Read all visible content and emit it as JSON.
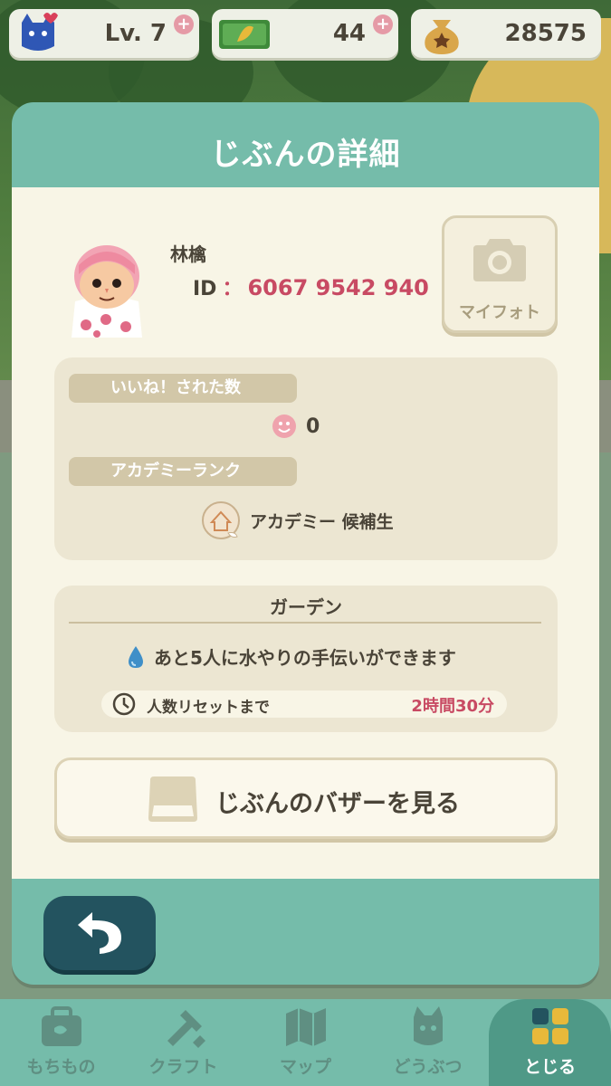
{
  "status_bar": {
    "level_label": "Lv. 7",
    "tickets_value": "44",
    "bells_value": "28575",
    "plus_symbol": "+"
  },
  "modal": {
    "title": "じぶんの詳細",
    "profile": {
      "name": "林檎",
      "id_label": "ID",
      "id_colon": "：",
      "id_value": "6067 9542 940",
      "myphoto_label": "マイフォト"
    },
    "likes": {
      "label": "いいね！された数",
      "value": "0"
    },
    "academy": {
      "label": "アカデミーランク",
      "value": "アカデミー 候補生"
    },
    "garden": {
      "title": "ガーデン",
      "water_text": "あと5人に水やりの手伝いができます",
      "reset_label": "人数リセットまで",
      "reset_time": "2時間30分"
    },
    "bazaar_label": "じぶんのバザーを見る"
  },
  "bottom_nav": {
    "items": [
      {
        "label": "もちもの",
        "icon": "bag-icon"
      },
      {
        "label": "クラフト",
        "icon": "hammer-icon"
      },
      {
        "label": "マップ",
        "icon": "map-icon"
      },
      {
        "label": "どうぶつ",
        "icon": "animal-icon"
      },
      {
        "label": "とじる",
        "icon": "grid-icon"
      }
    ],
    "active_index": 4
  },
  "colors": {
    "teal": "#75bcaa",
    "accent_red": "#c84a63",
    "cream": "#f8f5e6",
    "dark_teal": "#23535f"
  }
}
